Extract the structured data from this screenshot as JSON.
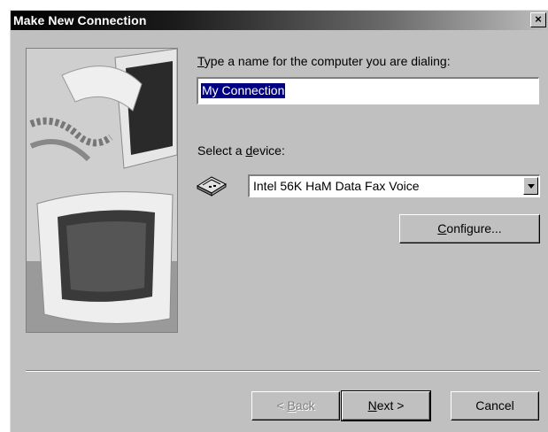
{
  "window": {
    "title": "Make New Connection",
    "close_glyph": "×"
  },
  "form": {
    "name_label": {
      "accel": "T",
      "rest": "ype a name for the computer you are dialing:"
    },
    "name_value": "My Connection",
    "device_label": {
      "pre": "Select a ",
      "accel": "d",
      "rest": "evice:"
    },
    "device_value": "Intel 56K HaM Data Fax Voice",
    "configure": {
      "accel": "C",
      "rest": "onfigure..."
    }
  },
  "buttons": {
    "back": {
      "pre": "< ",
      "accel": "B",
      "rest": "ack"
    },
    "next": {
      "accel": "N",
      "rest": "ext >"
    },
    "cancel": "Cancel"
  },
  "icons": {
    "modem": "modem-icon",
    "dropdown": "chevron-down-icon",
    "close": "close-icon"
  },
  "colors": {
    "face": "#c0c0c0",
    "selection": "#000080",
    "title_start": "#000000",
    "title_end": "#bdbdbd"
  }
}
